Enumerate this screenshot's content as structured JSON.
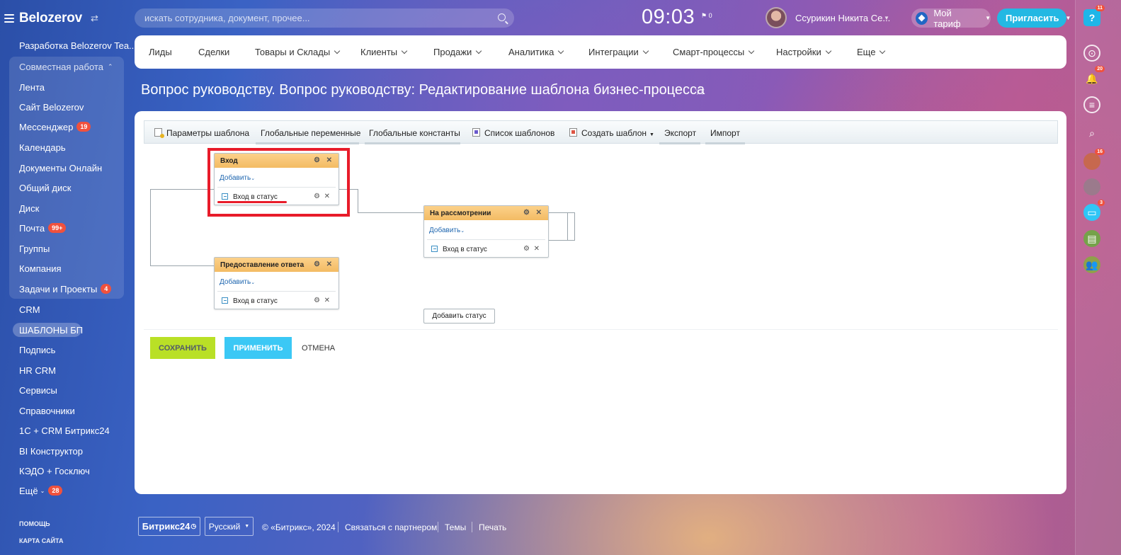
{
  "sidebar": {
    "logo": "Belozerov",
    "workspace": "Разработка Belozerov Tea...",
    "group_title": "Совместная работа",
    "group_items": [
      {
        "label": "Лента",
        "badge": ""
      },
      {
        "label": "Сайт Belozerov",
        "badge": ""
      },
      {
        "label": "Мессенджер",
        "badge": "19"
      },
      {
        "label": "Календарь",
        "badge": ""
      },
      {
        "label": "Документы Онлайн",
        "badge": ""
      },
      {
        "label": "Общий диск",
        "badge": ""
      },
      {
        "label": "Диск",
        "badge": ""
      },
      {
        "label": "Почта",
        "badge": "99+"
      },
      {
        "label": "Группы",
        "badge": ""
      },
      {
        "label": "Компания",
        "badge": ""
      },
      {
        "label": "Задачи и Проекты",
        "badge": "4"
      }
    ],
    "items": [
      {
        "label": "CRM",
        "badge": ""
      },
      {
        "label": "ШАБЛОНЫ БП",
        "badge": ""
      },
      {
        "label": "Подпись",
        "badge": ""
      },
      {
        "label": "HR CRM",
        "badge": ""
      },
      {
        "label": "Сервисы",
        "badge": ""
      },
      {
        "label": "Справочники",
        "badge": ""
      },
      {
        "label": "1С + CRM Битрикс24",
        "badge": ""
      },
      {
        "label": "BI Конструктор",
        "badge": ""
      },
      {
        "label": "КЭДО + Госключ",
        "badge": ""
      },
      {
        "label": "Ещё",
        "badge": "28"
      }
    ],
    "help": "ПОМОЩЬ",
    "sitemap": "КАРТА САЙТА"
  },
  "header": {
    "search_placeholder": "искать сотрудника, документ, прочее...",
    "time": "09:03",
    "flag_count": "0",
    "user_name": "Ссурикин Никита Се...",
    "tariff": "Мой тариф",
    "invite": "Пригласить"
  },
  "rail": {
    "help_badge": "11",
    "bell_badge": "20",
    "avatar1_badge": "16",
    "chat_badge": "3"
  },
  "topnav": [
    "Лиды",
    "Сделки",
    "Товары и Склады",
    "Клиенты",
    "Продажи",
    "Аналитика",
    "Интеграции",
    "Смарт-процессы",
    "Настройки",
    "Еще"
  ],
  "page_title": "Вопрос руководству. Вопрос руководству: Редактирование шаблона бизнес-процесса",
  "toolbar": {
    "template_params": "Параметры шаблона",
    "global_vars": "Глобальные переменные",
    "global_consts": "Глобальные константы",
    "template_list": "Список шаблонов",
    "create_template": "Создать шаблон",
    "export": "Экспорт",
    "import": "Импорт"
  },
  "states": [
    {
      "title": "Вход",
      "add": "Добавить",
      "action": "Вход в статус"
    },
    {
      "title": "На рассмотрении",
      "add": "Добавить",
      "action": "Вход в статус"
    },
    {
      "title": "Предоставление ответа",
      "add": "Добавить",
      "action": "Вход в статус"
    }
  ],
  "add_status": "Добавить статус",
  "buttons": {
    "save": "СОХРАНИТЬ",
    "apply": "ПРИМЕНИТЬ",
    "cancel": "ОТМЕНА"
  },
  "footer": {
    "logo": "Битрикс24",
    "lang": "Русский",
    "copyright": "© «Битрикс», 2024",
    "partner": "Связаться с партнером",
    "themes": "Темы",
    "print": "Печать"
  }
}
